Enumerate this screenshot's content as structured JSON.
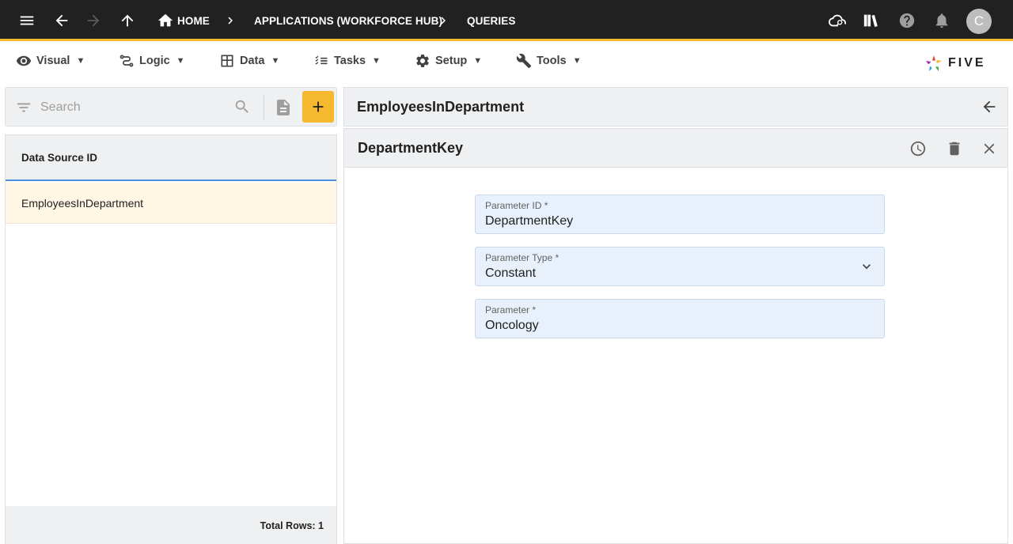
{
  "topbar": {
    "breadcrumbs": [
      {
        "label": "HOME"
      },
      {
        "label": "APPLICATIONS (WORKFORCE HUB)"
      },
      {
        "label": "QUERIES"
      }
    ],
    "avatar_initial": "C",
    "accent_color": "#f5b82e"
  },
  "menubar": {
    "items": [
      {
        "label": "Visual",
        "icon": "eye-icon"
      },
      {
        "label": "Logic",
        "icon": "logic-icon"
      },
      {
        "label": "Data",
        "icon": "table-icon"
      },
      {
        "label": "Tasks",
        "icon": "checklist-icon"
      },
      {
        "label": "Setup",
        "icon": "gear-icon"
      },
      {
        "label": "Tools",
        "icon": "tools-icon"
      }
    ],
    "caret": "▼",
    "logo_text": "FIVE"
  },
  "left": {
    "search": {
      "placeholder": "Search",
      "value": ""
    },
    "column_header": "Data Source ID",
    "rows": [
      {
        "data_source_id": "EmployeesInDepartment"
      }
    ],
    "total_rows": "Total Rows: 1"
  },
  "right": {
    "title": "EmployeesInDepartment",
    "form": {
      "title": "DepartmentKey",
      "fields": [
        {
          "label": "Parameter ID *",
          "value": "DepartmentKey"
        },
        {
          "label": "Parameter Type *",
          "value": "Constant"
        },
        {
          "label": "Parameter *",
          "value": "Oncology"
        }
      ]
    }
  }
}
